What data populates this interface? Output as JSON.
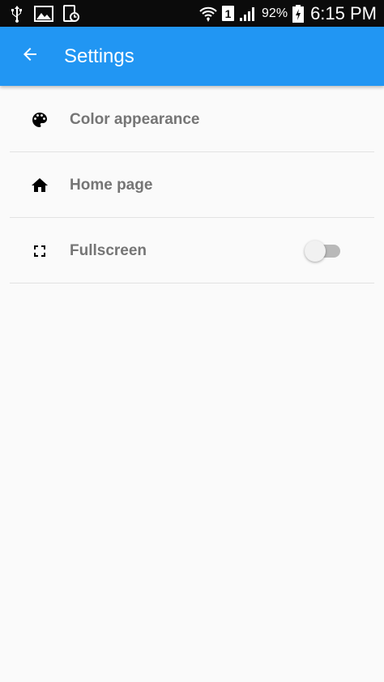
{
  "status_bar": {
    "battery": "92%",
    "sim_slot": "1",
    "time": "6:15 PM",
    "icons": [
      "usb-icon",
      "image-icon",
      "screenshot-icon",
      "wifi-icon",
      "sim-icon",
      "signal-icon",
      "battery-charging-icon"
    ]
  },
  "app_bar": {
    "title": "Settings",
    "back_icon": "arrow-back-icon",
    "color": "#2196f3"
  },
  "settings": {
    "items": [
      {
        "label": "Color appearance",
        "icon": "palette-icon"
      },
      {
        "label": "Home page",
        "icon": "home-icon"
      },
      {
        "label": "Fullscreen",
        "icon": "fullscreen-icon",
        "toggle": false
      }
    ]
  }
}
